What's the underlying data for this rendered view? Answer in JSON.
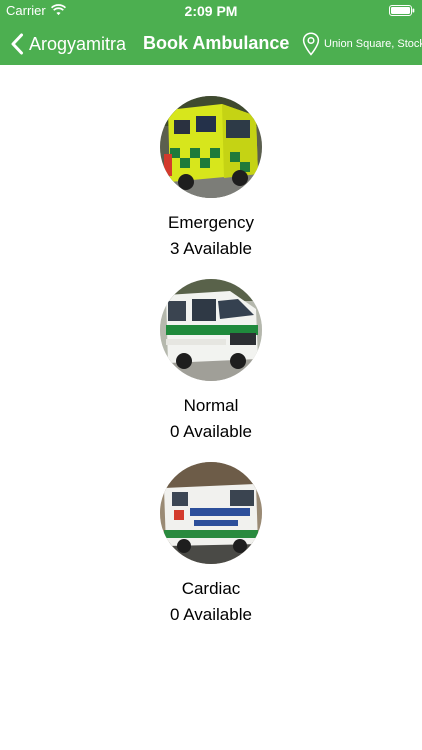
{
  "status_bar": {
    "carrier": "Carrier",
    "time": "2:09 PM",
    "wifi_icon": "wifi-icon",
    "battery_icon": "battery-icon"
  },
  "nav": {
    "back_label": "Arogyamitra",
    "back_icon": "chevron-left-icon",
    "title": "Book Ambulance",
    "location_icon": "map-pin-icon",
    "location": "Union Square, Stockton"
  },
  "colors": {
    "header": "#4caf50",
    "header_text": "#ffffff",
    "background": "#ffffff",
    "text": "#000000"
  },
  "ambulances": [
    {
      "name": "Emergency",
      "availability": "3 Available"
    },
    {
      "name": "Normal",
      "availability": "0 Available"
    },
    {
      "name": "Cardiac",
      "availability": "0 Available"
    }
  ]
}
